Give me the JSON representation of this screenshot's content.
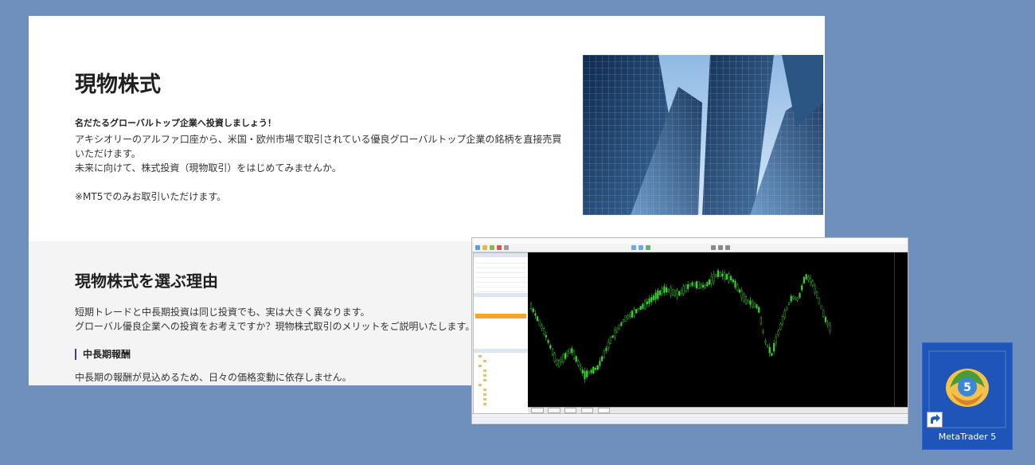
{
  "section1": {
    "title": "現物株式",
    "lead": "名だたるグローバルトップ企業へ投資しましょう！",
    "body_line1": "アキシオリーのアルファ口座から、米国・欧州市場で取引されている優良グローバルトップ企業の銘柄を直接売買いただけます。",
    "body_line2": "未来に向けて、株式投資（現物取引）をはじめてみませんか。",
    "note": "※MT5でのみお取引いただけます。"
  },
  "section2": {
    "title": "現物株式を選ぶ理由",
    "body_line1": "短期トレードと中長期投資は同じ投資でも、実は大きく異なります。",
    "body_line2": "グローバル優良企業への投資をお考えですか？現物株式取引のメリットをご説明いたします。",
    "subheading": "中長期報酬",
    "sub_body": "中長期の報酬が見込めるため、日々の価格変動に依存しません。"
  },
  "desktop_icon": {
    "label": "MetaTrader 5",
    "badge": "5"
  },
  "colors": {
    "background": "#6f8fbd",
    "chart_bg": "#000000",
    "candle": "#35d62a",
    "desktop_tile": "#1f55b8",
    "accent_bar": "#3a3f8f"
  }
}
